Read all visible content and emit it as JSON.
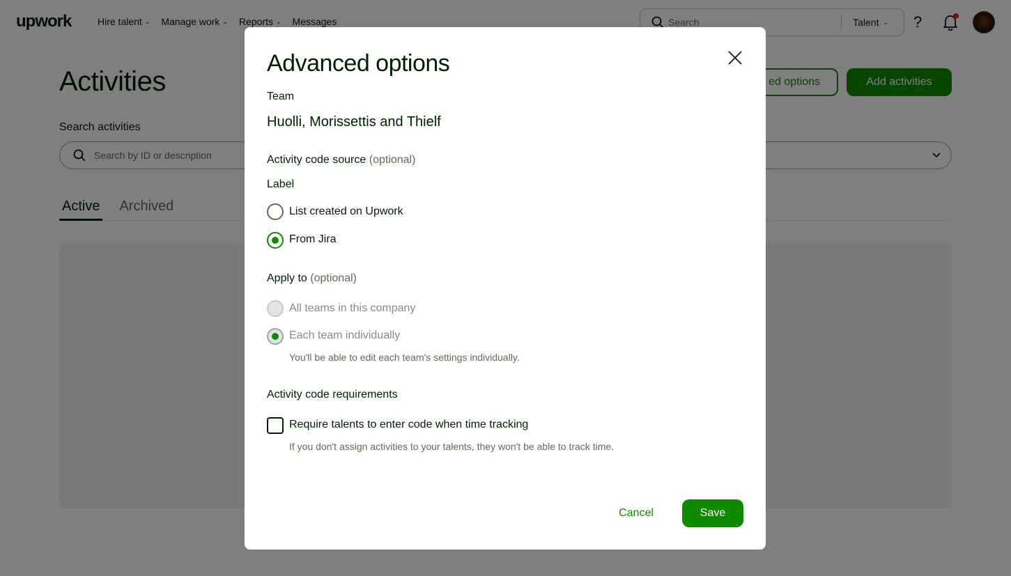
{
  "header": {
    "logo": "upwork",
    "nav": [
      {
        "label": "Hire talent",
        "has_dropdown": true
      },
      {
        "label": "Manage work",
        "has_dropdown": true
      },
      {
        "label": "Reports",
        "has_dropdown": true
      },
      {
        "label": "Messages",
        "has_dropdown": false
      }
    ],
    "search_placeholder": "Search",
    "search_scope": "Talent",
    "notification_dot_color": "#d93025"
  },
  "page": {
    "title": "Activities",
    "advanced_options_button": "Advanced options",
    "advanced_options_visible": "ed options",
    "add_activities_button": "Add activities",
    "search_label": "Search activities",
    "search_placeholder": "Search by ID or description",
    "tabs": [
      {
        "label": "Active",
        "active": true
      },
      {
        "label": "Archived",
        "active": false
      }
    ]
  },
  "modal": {
    "title": "Advanced options",
    "team_label": "Team",
    "team_name": "Huolli, Morissettis and Thielf",
    "source_label": "Activity code source",
    "optional": "(optional)",
    "label_heading": "Label",
    "source_options": [
      {
        "label": "List created on Upwork",
        "checked": false
      },
      {
        "label": "From Jira",
        "checked": true
      }
    ],
    "apply_label": "Apply to",
    "apply_options": [
      {
        "label": "All teams in this company",
        "checked": false,
        "disabled": true
      },
      {
        "label": "Each team individually",
        "checked": true,
        "disabled": true
      }
    ],
    "apply_helper": "You'll be able to edit each team's settings individually.",
    "requirements_label": "Activity code requirements",
    "require_checkbox_label": "Require talents to enter code when time tracking",
    "require_checked": false,
    "require_helper": "If you don't assign activities to your talents, they won't be able to track time.",
    "cancel_label": "Cancel",
    "save_label": "Save"
  },
  "colors": {
    "brand_green": "#108a00",
    "text": "#001e00",
    "muted": "#5e6d55"
  }
}
